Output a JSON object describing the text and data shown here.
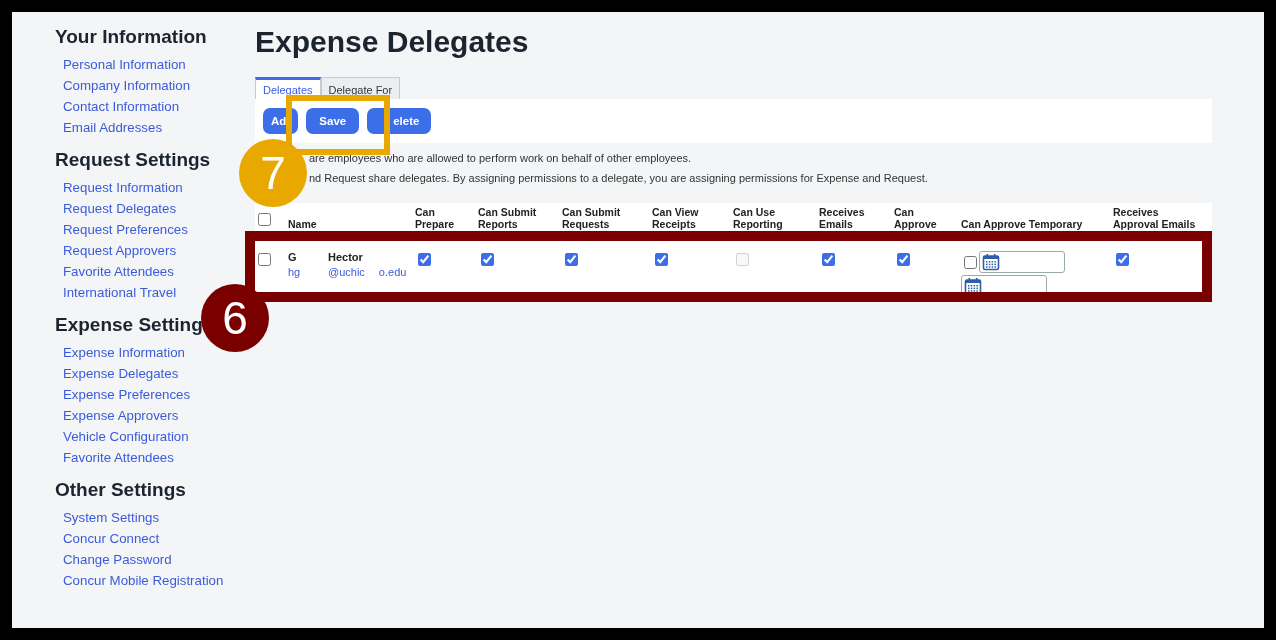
{
  "sidebar": {
    "sections": [
      {
        "title": "Your Information",
        "items": [
          "Personal Information",
          "Company Information",
          "Contact Information",
          "Email Addresses"
        ]
      },
      {
        "title": "Request Settings",
        "items": [
          "Request Information",
          "Request Delegates",
          "Request Preferences",
          "Request Approvers",
          "Favorite Attendees",
          "International Travel"
        ]
      },
      {
        "title": "Expense Setting",
        "items": [
          "Expense Information",
          "Expense Delegates",
          "Expense Preferences",
          "Expense Approvers",
          "Vehicle Configuration",
          "Favorite Attendees"
        ]
      },
      {
        "title": "Other Settings",
        "items": [
          "System Settings",
          "Concur Connect",
          "Change Password",
          "Concur Mobile Registration"
        ]
      }
    ]
  },
  "title": "Expense Delegates",
  "tabs": [
    {
      "label": "Delegates",
      "selected": true
    },
    {
      "label": "Delegate For",
      "selected": false
    }
  ],
  "toolbar": {
    "buttons": [
      "Ad",
      "Save",
      "elete"
    ]
  },
  "description": [
    "are employees who are allowed to perform work on behalf of other employees.",
    "nd Request share delegates. By assigning permissions to a delegate, you are assigning permissions for Expense and Request."
  ],
  "table": {
    "select_all": {
      "checked": false
    },
    "columns": [
      "Name",
      "Can Prepare",
      "Can Submit Reports",
      "Can Submit Requests",
      "Can View Receipts",
      "Can Use Reporting",
      "Receives Emails",
      "Can Approve",
      "Can Approve Temporary",
      "Receives Approval Emails"
    ],
    "rows": [
      {
        "checked": false,
        "initials": "G",
        "username": "hg",
        "first_name": "Hector",
        "email_parts": [
          "@uchic",
          "o.edu"
        ],
        "cells": [
          {
            "kind": "checkbox",
            "checked": true,
            "disabled": false
          },
          {
            "kind": "checkbox",
            "checked": true,
            "disabled": false
          },
          {
            "kind": "checkbox",
            "checked": true,
            "disabled": false
          },
          {
            "kind": "checkbox",
            "checked": true,
            "disabled": false
          },
          {
            "kind": "checkbox",
            "checked": false,
            "disabled": true
          },
          {
            "kind": "checkbox",
            "checked": true,
            "disabled": false
          },
          {
            "kind": "checkbox",
            "checked": true,
            "disabled": false
          },
          {
            "kind": "temporary",
            "checked": false,
            "disabled": false
          },
          {
            "kind": "checkbox",
            "checked": true,
            "disabled": false
          }
        ]
      }
    ]
  },
  "callouts": [
    {
      "number": "7",
      "color": "#e8a800"
    },
    {
      "number": "6",
      "color": "#7a0000"
    }
  ]
}
